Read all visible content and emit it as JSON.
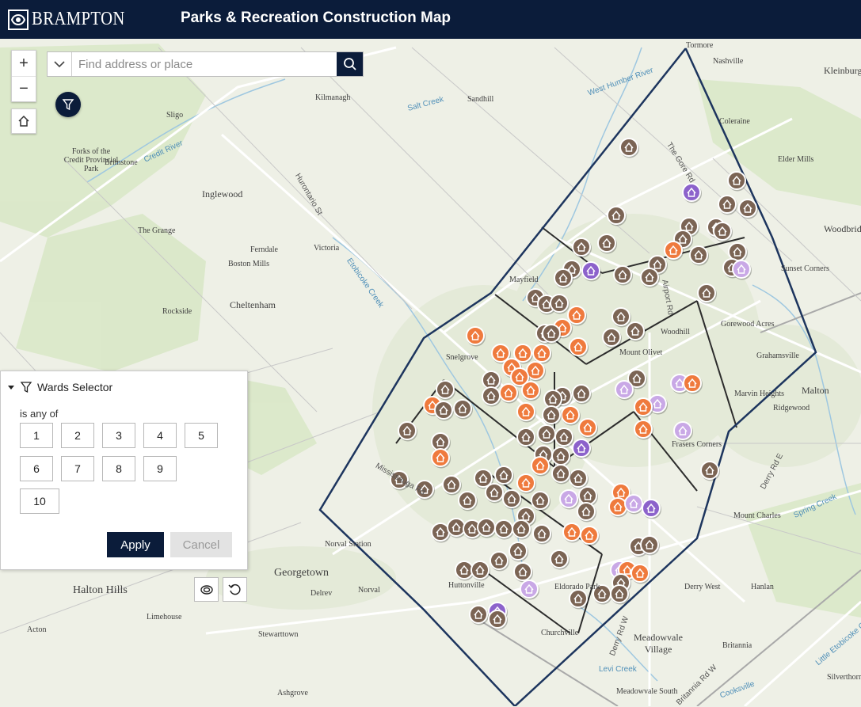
{
  "header": {
    "brand": "BRAMPTON",
    "title": "Parks & Recreation Construction Map"
  },
  "controls": {
    "zoom_in": "+",
    "zoom_out": "−"
  },
  "search": {
    "placeholder": "Find address or place"
  },
  "filter_panel": {
    "title": "Wards Selector",
    "condition": "is any of",
    "wards": [
      "1",
      "2",
      "3",
      "4",
      "5",
      "6",
      "7",
      "8",
      "9",
      "10"
    ],
    "apply_label": "Apply",
    "cancel_label": "Cancel"
  },
  "colors": {
    "header_bg": "#0b1c3a",
    "boundary": "#1d355e",
    "marker_brown": "#7b6454",
    "marker_orange": "#ef7a3d",
    "marker_purple": "#8c62cb",
    "marker_lilac": "#c9a8e6"
  },
  "icons": [
    "brampton-logo",
    "chevron-down-icon",
    "search-icon",
    "filter-icon",
    "home-icon",
    "caret-down-icon",
    "layers-icon",
    "reset-icon"
  ],
  "map_labels": [
    {
      "text": "Tormore",
      "size": 10
    },
    {
      "text": "Nashville",
      "size": 10
    },
    {
      "text": "Kleinburg",
      "size": 12
    },
    {
      "text": "Kilmanagh",
      "size": 10
    },
    {
      "text": "Sandhill",
      "size": 10
    },
    {
      "text": "Sligo",
      "size": 10
    },
    {
      "text": "Coleraine",
      "size": 10
    },
    {
      "text": "Forks of the Credit Provincial Park",
      "size": 10
    },
    {
      "text": "Brimstone",
      "size": 10
    },
    {
      "text": "Elder Mills",
      "size": 10
    },
    {
      "text": "Inglewood",
      "size": 12
    },
    {
      "text": "Woodbridge",
      "size": 12
    },
    {
      "text": "The Grange",
      "size": 10
    },
    {
      "text": "Ferndale",
      "size": 10
    },
    {
      "text": "Victoria",
      "size": 10
    },
    {
      "text": "Boston Mills",
      "size": 10
    },
    {
      "text": "Sunset Corners",
      "size": 10
    },
    {
      "text": "Cheltenham",
      "size": 12
    },
    {
      "text": "Mayfield",
      "size": 10
    },
    {
      "text": "Rockside",
      "size": 10
    },
    {
      "text": "Gorewood Acres",
      "size": 10
    },
    {
      "text": "Woodhill",
      "size": 10
    },
    {
      "text": "Mount Olivet",
      "size": 10
    },
    {
      "text": "Snelgrove",
      "size": 10
    },
    {
      "text": "Grahamsville",
      "size": 10
    },
    {
      "text": "Malton",
      "size": 12
    },
    {
      "text": "Marvin Heights",
      "size": 10
    },
    {
      "text": "Ridgewood",
      "size": 10
    },
    {
      "text": "Frasers Corners",
      "size": 10
    },
    {
      "text": "Mount Charles",
      "size": 10
    },
    {
      "text": "Norval Station",
      "size": 10
    },
    {
      "text": "Georgetown",
      "size": 14
    },
    {
      "text": "Halton Hills",
      "size": 14
    },
    {
      "text": "Huttonville",
      "size": 10
    },
    {
      "text": "Eldorado Park",
      "size": 10
    },
    {
      "text": "Derry West",
      "size": 10
    },
    {
      "text": "Hanlan",
      "size": 10
    },
    {
      "text": "Delrev",
      "size": 10
    },
    {
      "text": "Norval",
      "size": 10
    },
    {
      "text": "Limehouse",
      "size": 10
    },
    {
      "text": "Churchville",
      "size": 10
    },
    {
      "text": "Acton",
      "size": 10
    },
    {
      "text": "Stewarttown",
      "size": 10
    },
    {
      "text": "Meadowvale Village",
      "size": 12
    },
    {
      "text": "Britannia",
      "size": 10
    },
    {
      "text": "Silverthorn",
      "size": 10
    },
    {
      "text": "Meadowvale South",
      "size": 10
    },
    {
      "text": "Ashgrove",
      "size": 10
    }
  ],
  "road_labels": [
    "Hurontario St",
    "Mississauga Rd",
    "The Gore Rd",
    "Airport Rd",
    "Derry Rd E",
    "Derry Rd W",
    "Britannia Rd W",
    "West Humber River",
    "Salt Creek",
    "Credit River",
    "Etobicoke Creek",
    "Levi Creek",
    "Spring Creek",
    "Little Etobicoke Creek",
    "Cooksville"
  ]
}
